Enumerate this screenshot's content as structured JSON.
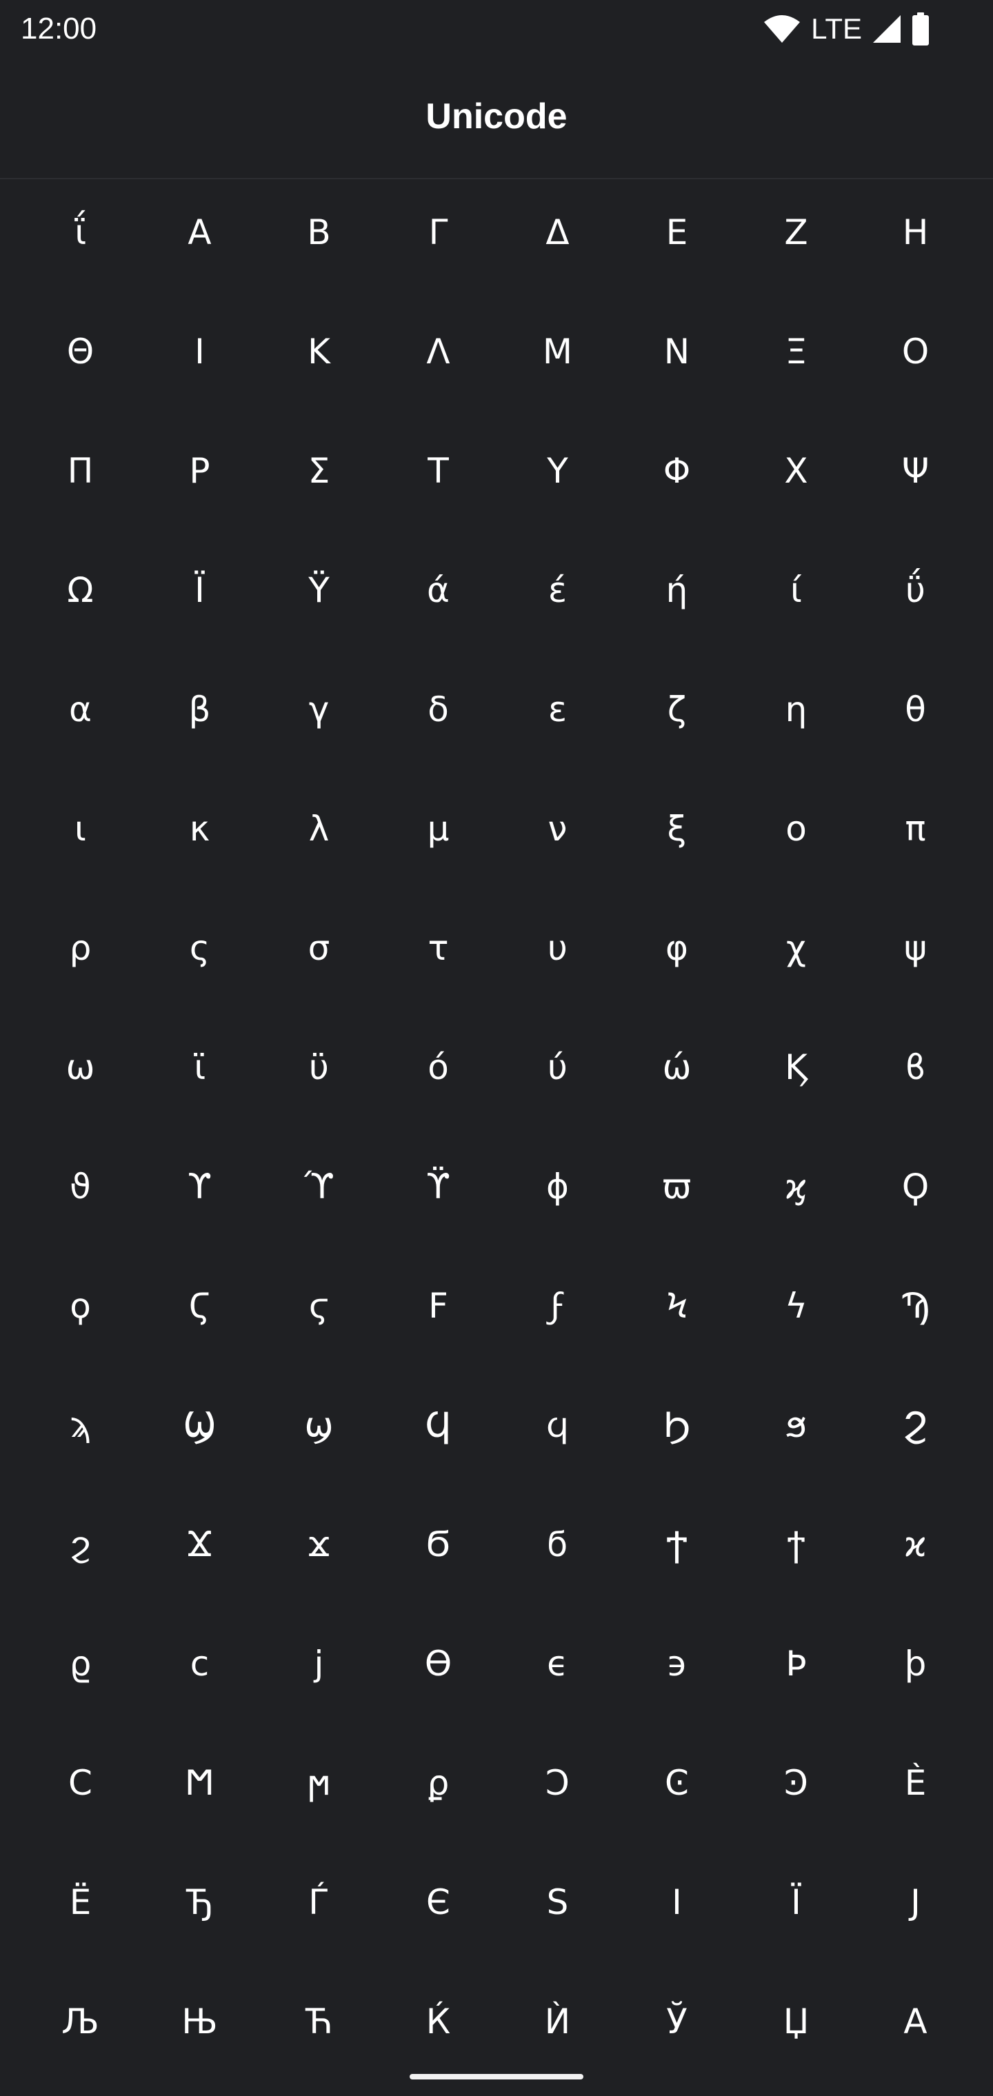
{
  "status_bar": {
    "time": "12:00",
    "network": "LTE",
    "icons": [
      "wifi-icon",
      "signal-icon",
      "battery-icon"
    ]
  },
  "app_bar": {
    "title": "Unicode"
  },
  "characters": [
    "ΐ",
    "Α",
    "Β",
    "Γ",
    "Δ",
    "Ε",
    "Ζ",
    "Η",
    "Θ",
    "Ι",
    "Κ",
    "Λ",
    "Μ",
    "Ν",
    "Ξ",
    "Ο",
    "Π",
    "Ρ",
    "Σ",
    "Τ",
    "Υ",
    "Φ",
    "Χ",
    "Ψ",
    "Ω",
    "Ϊ",
    "Ϋ",
    "ά",
    "έ",
    "ή",
    "ί",
    "ΰ",
    "α",
    "β",
    "γ",
    "δ",
    "ε",
    "ζ",
    "η",
    "θ",
    "ι",
    "κ",
    "λ",
    "μ",
    "ν",
    "ξ",
    "ο",
    "π",
    "ρ",
    "ς",
    "σ",
    "τ",
    "υ",
    "φ",
    "χ",
    "ψ",
    "ω",
    "ϊ",
    "ϋ",
    "ό",
    "ύ",
    "ώ",
    "Ϗ",
    "ϐ",
    "ϑ",
    "ϒ",
    "ϓ",
    "ϔ",
    "ϕ",
    "ϖ",
    "ϗ",
    "Ϙ",
    "ϙ",
    "Ϛ",
    "ϛ",
    "Ϝ",
    "ϝ",
    "Ϟ",
    "ϟ",
    "Ϡ",
    "ϡ",
    "Ϣ",
    "ϣ",
    "Ϥ",
    "ϥ",
    "Ϧ",
    "ϧ",
    "Ϩ",
    "ϩ",
    "Ϫ",
    "ϫ",
    "Ϭ",
    "ϭ",
    "Ϯ",
    "ϯ",
    "ϰ",
    "ϱ",
    "ϲ",
    "ϳ",
    "ϴ",
    "ϵ",
    "϶",
    "Ϸ",
    "ϸ",
    "Ϲ",
    "Ϻ",
    "ϻ",
    "ϼ",
    "Ͻ",
    "Ͼ",
    "Ͽ",
    "Ѐ",
    "Ё",
    "Ђ",
    "Ѓ",
    "Є",
    "Ѕ",
    "І",
    "Ї",
    "Ј",
    "Љ",
    "Њ",
    "Ћ",
    "Ќ",
    "Ѝ",
    "Ў",
    "Џ",
    "А"
  ],
  "colors": {
    "background": "#1f2023",
    "text": "#ffffff",
    "divider": "#2c2d31"
  }
}
